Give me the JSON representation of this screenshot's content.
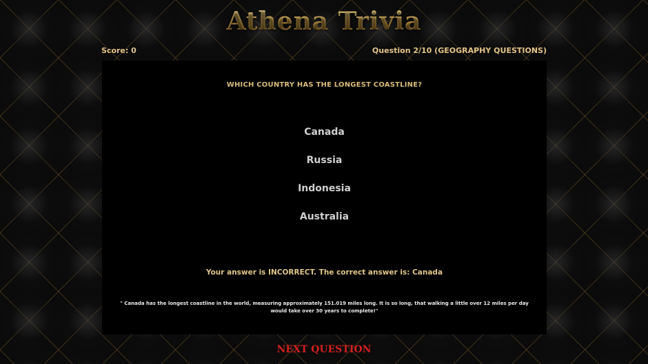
{
  "game": {
    "title": "Athena Trivia"
  },
  "hud": {
    "score": "Score: 0",
    "progress": "Question 2/10 (GEOGRAPHY QUESTIONS)"
  },
  "question": {
    "text": "WHICH COUNTRY HAS THE LONGEST COASTLINE?",
    "answers": [
      "Canada",
      "Russia",
      "Indonesia",
      "Australia"
    ]
  },
  "feedback": {
    "result": "Your answer is INCORRECT. The correct answer is: Canada",
    "fact": "\" Canada has the longest coastline in the world, measuring approximately 151.019 miles long. It is so long, that walking a little over 12 miles per day would take over 30 years to complete!\""
  },
  "controls": {
    "next_label": "NEXT QUESTION"
  },
  "colors": {
    "gold": "#d8bb7c",
    "next_red": "#d3201f",
    "panel": "#000000"
  }
}
